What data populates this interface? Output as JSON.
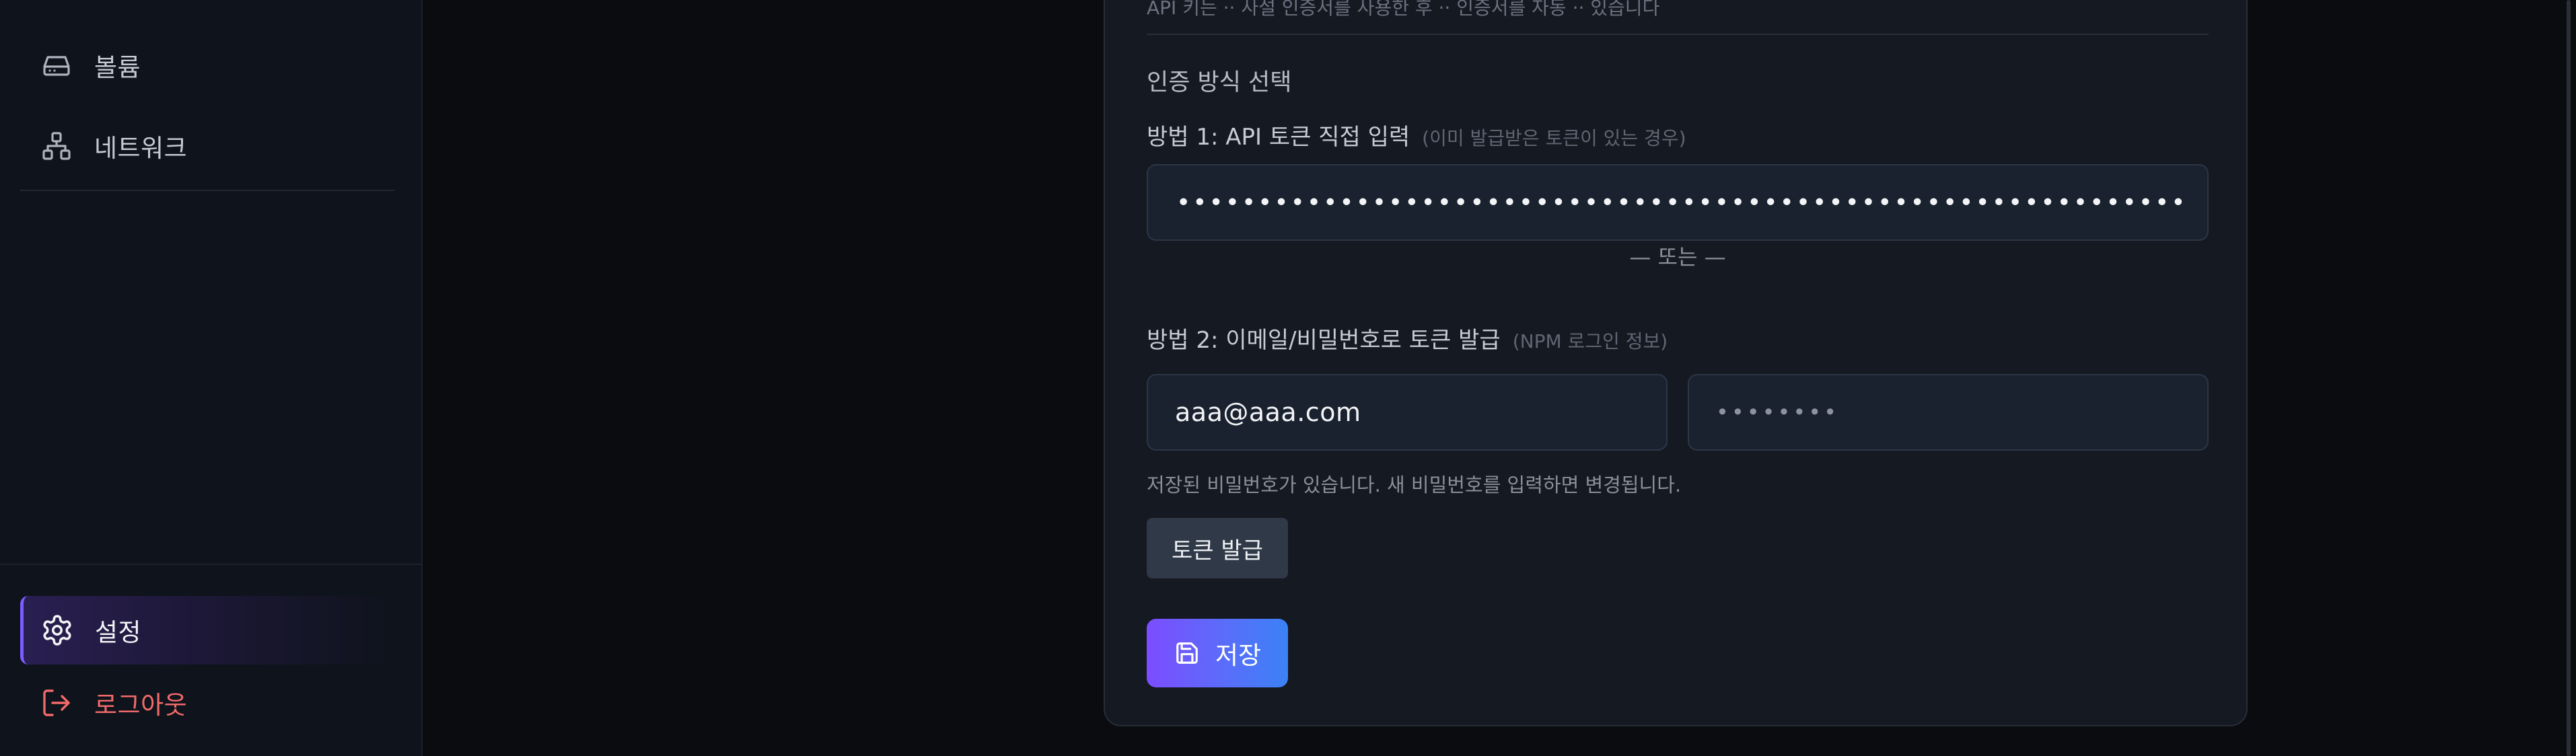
{
  "sidebar": {
    "items": [
      {
        "label": "볼륨",
        "icon": "hard-drive-icon"
      },
      {
        "label": "네트워크",
        "icon": "network-icon"
      }
    ],
    "bottom": {
      "settings_label": "설정",
      "logout_label": "로그아웃"
    }
  },
  "card": {
    "top_partial_text": "API 키는 ·· 사설 인증서를 사용한 후 ·· 인증서를 자동 ·· 있습니다",
    "auth_section_title": "인증 방식 선택",
    "method1": {
      "label": "방법 1: API 토큰 직접 입력",
      "hint": "(이미 발급받은 토큰이 있는 경우)",
      "token_masked": "••••••••••••••••••••••••••••••••••••••••••••••••••••••••••••••••••••••••••••••••••••••••••••••••••••"
    },
    "separator": "— 또는 —",
    "method2": {
      "label": "방법 2: 이메일/비밀번호로 토큰 발급",
      "hint": "(NPM 로그인 정보)",
      "email_value": "aaa@aaa.com",
      "password_masked": "••••••••",
      "help_text": "저장된 비밀번호가 있습니다. 새 비밀번호를 입력하면 변경됩니다.",
      "issue_button_label": "토큰 발급"
    },
    "save_button_label": "저장"
  },
  "colors": {
    "accent_start": "#7c4dff",
    "accent_end": "#3b82f6",
    "logout": "#f26b6b",
    "background": "#0b0c10",
    "card": "#151921"
  }
}
